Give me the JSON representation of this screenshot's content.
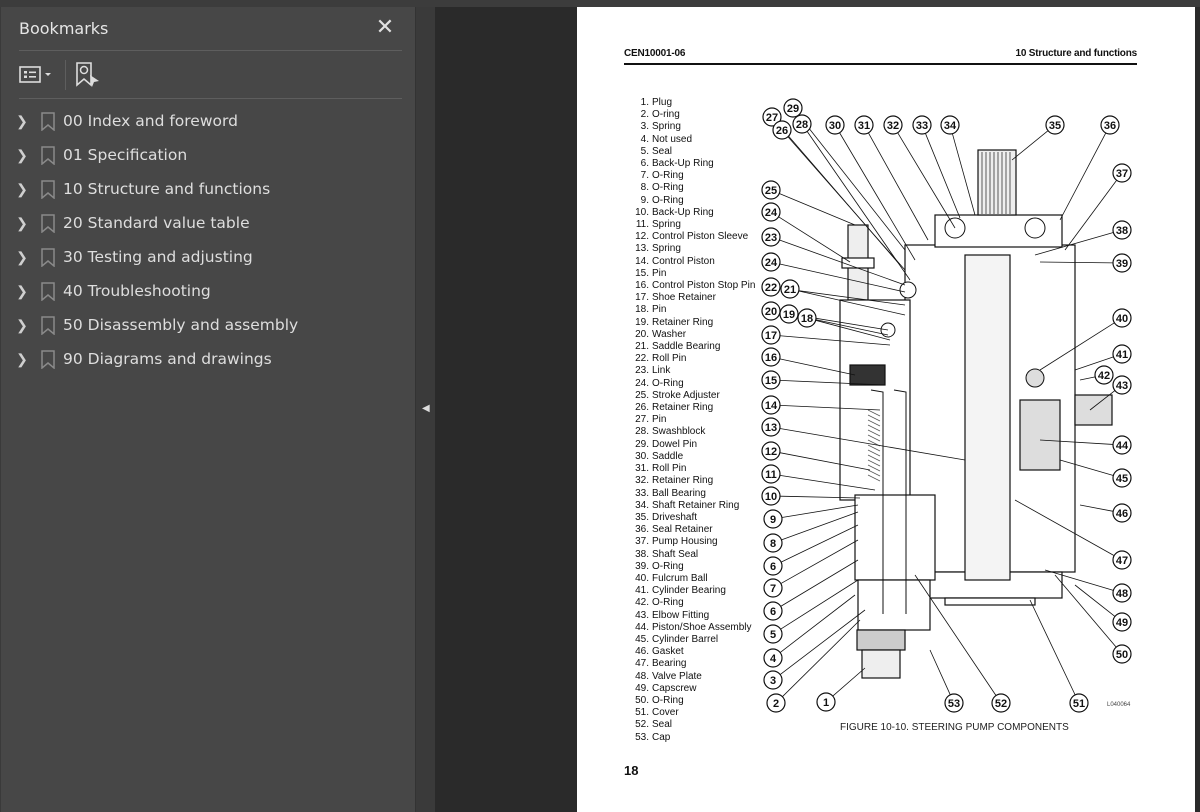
{
  "sidebar": {
    "title": "Bookmarks",
    "close_icon": "close-icon",
    "toolbar": {
      "options_icon": "list-options-icon",
      "find_icon": "find-current-bookmark-icon"
    },
    "items": [
      {
        "label": "00 Index and foreword"
      },
      {
        "label": "01 Specification"
      },
      {
        "label": "10 Structure and functions"
      },
      {
        "label": "20 Standard value table"
      },
      {
        "label": "30 Testing and adjusting"
      },
      {
        "label": "40 Troubleshooting"
      },
      {
        "label": "50 Disassembly and assembly"
      },
      {
        "label": "90 Diagrams and drawings"
      }
    ]
  },
  "page": {
    "header_left": "CEN10001-06",
    "header_right": "10 Structure and functions",
    "parts": [
      "Plug",
      "O-ring",
      "Spring",
      "Not used",
      "Seal",
      "Back-Up Ring",
      "O-Ring",
      "O-Ring",
      "O-Ring",
      "Back-Up Ring",
      "Spring",
      "Control Piston Sleeve",
      "Spring",
      "Control Piston",
      "Pin",
      "Control Piston Stop Pin",
      "Shoe Retainer",
      "Pin",
      "Retainer Ring",
      "Washer",
      "Saddle Bearing",
      "Roll Pin",
      "Link",
      "O-Ring",
      "Stroke Adjuster",
      "Retainer Ring",
      "Pin",
      "Swashblock",
      "Dowel Pin",
      "Saddle",
      "Roll Pin",
      "Retainer Ring",
      "Ball Bearing",
      "Shaft Retainer Ring",
      "Driveshaft",
      "Seal Retainer",
      "Pump Housing",
      "Shaft Seal",
      "O-Ring",
      "Fulcrum Ball",
      "Cylinder Bearing",
      "O-Ring",
      "Elbow Fitting",
      "Piston/Shoe Assembly",
      "Cylinder Barrel",
      "Gasket",
      "Bearing",
      "Valve Plate",
      "Capscrew",
      "O-Ring",
      "Cover",
      "Seal",
      "Cap"
    ],
    "callouts": [
      "29",
      "27",
      "28",
      "26",
      "30",
      "31",
      "32",
      "33",
      "34",
      "35",
      "36",
      "37",
      "38",
      "39",
      "40",
      "41",
      "42",
      "43",
      "44",
      "45",
      "46",
      "47",
      "48",
      "49",
      "50",
      "51",
      "52",
      "53",
      "25",
      "24",
      "23",
      "24",
      "22",
      "21",
      "20",
      "19",
      "18",
      "17",
      "16",
      "15",
      "14",
      "13",
      "12",
      "11",
      "10",
      "9",
      "8",
      "6",
      "7",
      "6",
      "5",
      "4",
      "3",
      "2",
      "1"
    ],
    "figure_id": "L040064",
    "caption": "FIGURE 10-10. STEERING PUMP COMPONENTS",
    "page_number": "18"
  },
  "colors": {
    "sidebar_bg": "#474747",
    "canvas_bg": "#2a2a2a",
    "page_bg": "#ffffff"
  }
}
